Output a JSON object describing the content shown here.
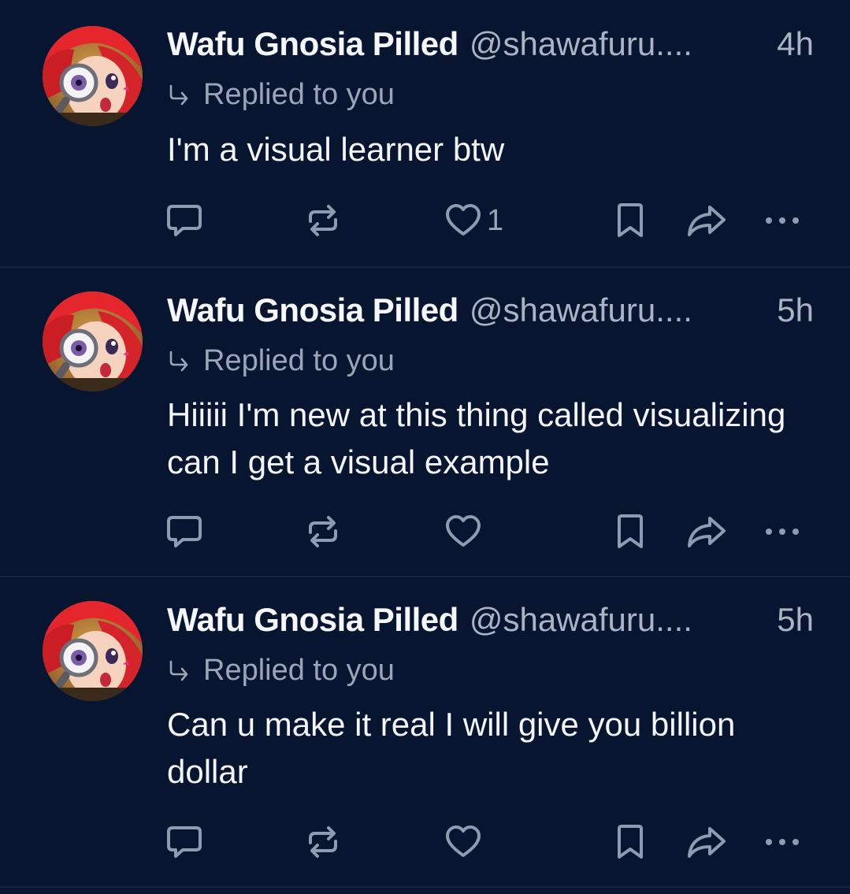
{
  "posts": [
    {
      "author": "Wafu Gnosia Pilled",
      "handle": "@shawafuru....",
      "time": "4h",
      "reply_context": "Replied to you",
      "text": "I'm a visual learner btw",
      "like_count": "1"
    },
    {
      "author": "Wafu Gnosia Pilled",
      "handle": "@shawafuru....",
      "time": "5h",
      "reply_context": "Replied to you",
      "text": "Hiiiii I'm new at this thing called visualizing can I get a visual example",
      "like_count": ""
    },
    {
      "author": "Wafu Gnosia Pilled",
      "handle": "@shawafuru....",
      "time": "5h",
      "reply_context": "Replied to you",
      "text": "Can u make it real I will give you billion dollar",
      "like_count": ""
    }
  ],
  "icons": {
    "reply": "speech-bubble-icon",
    "repost": "repost-icon",
    "like": "heart-icon",
    "bookmark": "bookmark-icon",
    "share": "share-arrow-icon",
    "more": "ellipsis-icon"
  },
  "colors": {
    "background": "#071530",
    "icon": "#8e9bb0",
    "text": "#f3f5f8",
    "muted": "#aab4c4"
  }
}
